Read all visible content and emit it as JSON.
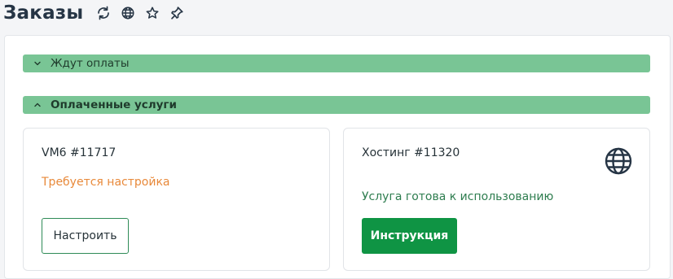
{
  "header": {
    "title": "Заказы",
    "icons": [
      "refresh-icon",
      "globe-icon",
      "star-icon",
      "pin-icon"
    ]
  },
  "sections": {
    "unpaid": {
      "label": "Ждут оплаты",
      "expanded": false
    },
    "paid": {
      "label": "Оплаченные услуги",
      "expanded": true
    }
  },
  "cards": [
    {
      "title": "VM6 #11717",
      "status": "Требуется настройка",
      "status_color": "#e8893a",
      "button": "Настроить"
    },
    {
      "title": "Хостинг #11320",
      "status": "Услуга готова к использованию",
      "status_color": "#2e7d4f",
      "button": "Инструкция",
      "icon": "globe-icon"
    }
  ],
  "colors": {
    "section_bar": "#79c595",
    "primary_button": "#0f9444",
    "title": "#263545"
  }
}
